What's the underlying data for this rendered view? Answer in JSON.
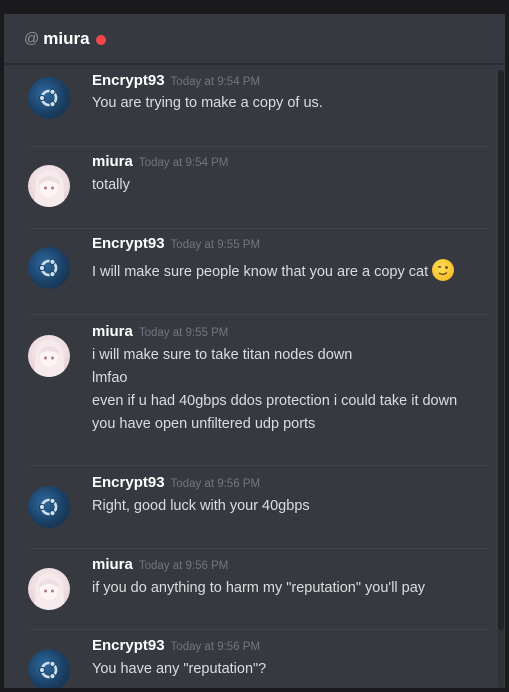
{
  "header": {
    "at_symbol": "@",
    "channel": "miura",
    "status_color": "#f04747"
  },
  "messages": [
    {
      "author": "Encrypt93",
      "avatar": "ubuntu-logo-icon",
      "time": "Today at 9:54 PM",
      "lines": [
        "You are trying to make a copy of us."
      ]
    },
    {
      "author": "miura",
      "avatar": "anime-girl-avatar",
      "time": "Today at 9:54 PM",
      "lines": [
        "totally"
      ]
    },
    {
      "author": "Encrypt93",
      "avatar": "ubuntu-logo-icon",
      "time": "Today at 9:55 PM",
      "lines": [
        "I will make sure people know that you are a copy cat"
      ],
      "emoji": "winking-face-emoji"
    },
    {
      "author": "miura",
      "avatar": "anime-girl-avatar",
      "time": "Today at 9:55 PM",
      "lines": [
        "i will make sure to take titan nodes down",
        "lmfao",
        "even if u had 40gbps ddos protection i could take it down",
        "you have open unfiltered udp ports"
      ]
    },
    {
      "author": "Encrypt93",
      "avatar": "ubuntu-logo-icon",
      "time": "Today at 9:56 PM",
      "lines": [
        "Right, good luck with your 40gbps"
      ]
    },
    {
      "author": "miura",
      "avatar": "anime-girl-avatar",
      "time": "Today at 9:56 PM",
      "lines": [
        "if you do anything to harm my \"reputation\" you'll pay"
      ]
    },
    {
      "author": "Encrypt93",
      "avatar": "ubuntu-logo-icon",
      "time": "Today at 9:56 PM",
      "lines": [
        "You have any \"reputation\"?"
      ]
    }
  ]
}
